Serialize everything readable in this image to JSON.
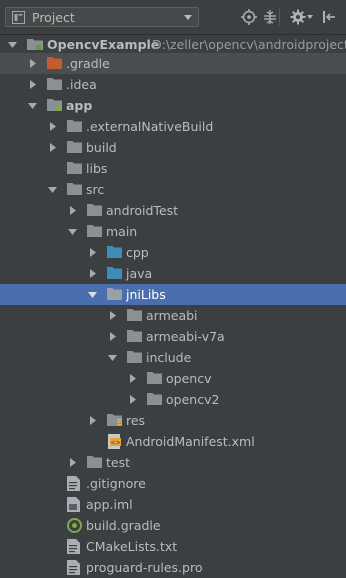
{
  "panel": {
    "title": "Project",
    "toolbar_icons": [
      "target-icon",
      "collapse-all-icon",
      "settings-icon",
      "hide-panel-icon"
    ]
  },
  "tree": {
    "root": {
      "name": "OpencvExample",
      "path": "D:\\zeller\\opencv\\androidproject"
    },
    "items": [
      {
        "label": ".gradle"
      },
      {
        "label": ".idea"
      },
      {
        "label": "app"
      },
      {
        "label": ".externalNativeBuild"
      },
      {
        "label": "build"
      },
      {
        "label": "libs"
      },
      {
        "label": "src"
      },
      {
        "label": "androidTest"
      },
      {
        "label": "main"
      },
      {
        "label": "cpp"
      },
      {
        "label": "java"
      },
      {
        "label": "jniLibs"
      },
      {
        "label": "armeabi"
      },
      {
        "label": "armeabi-v7a"
      },
      {
        "label": "include"
      },
      {
        "label": "opencv"
      },
      {
        "label": "opencv2"
      },
      {
        "label": "res"
      },
      {
        "label": "AndroidManifest.xml"
      },
      {
        "label": "test"
      },
      {
        "label": ".gitignore"
      },
      {
        "label": "app.iml"
      },
      {
        "label": "build.gradle"
      },
      {
        "label": "CMakeLists.txt"
      },
      {
        "label": "proguard-rules.pro"
      }
    ]
  },
  "colors": {
    "background": "#3c3f41",
    "selection": "#4b6eaf",
    "folder": "#8b9094",
    "folder_excluded": "#c35d2e",
    "folder_source": "#3e8cb8",
    "text": "#bbbbbb",
    "path_text": "#9a9a9a"
  }
}
